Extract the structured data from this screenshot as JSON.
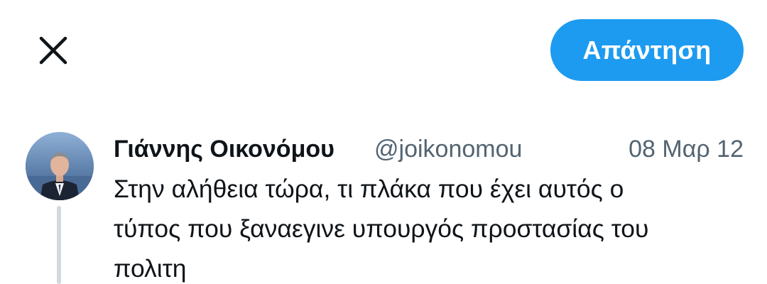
{
  "toolbar": {
    "close_icon": "close-icon",
    "reply_label": "Απάντηση",
    "accent_color": "#1d9bf0"
  },
  "tweet": {
    "author_name": "Γιάννης Οικονόμου",
    "author_handle": "@joikonomou",
    "date": "08 Μαρ 12",
    "text": "Στην αλήθεια τώρα, τι πλάκα που έχει αυτός ο\nτύπος που ξαναεγινε υπουργός προστασίας του\nπολιτη"
  }
}
